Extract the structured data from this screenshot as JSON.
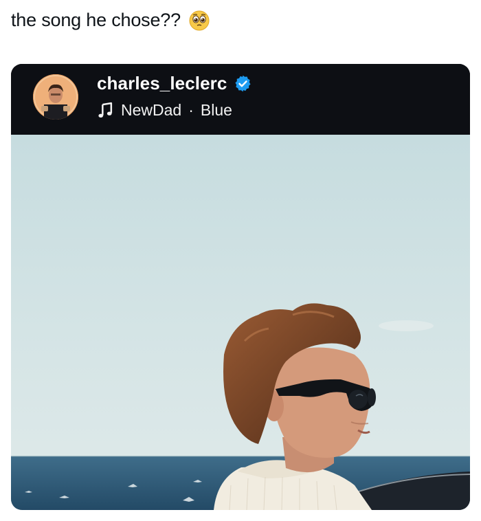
{
  "tweet": {
    "text": "the song he chose??",
    "emoji": "pleading-face-emoji"
  },
  "post": {
    "username": "charles_leclerc",
    "verified": true,
    "music": {
      "artist": "NewDad",
      "separator": "·",
      "title": "Blue"
    }
  },
  "colors": {
    "header_bg": "#0d0f14",
    "verified_blue": "#1d9bf0",
    "sky": "#cfe1e3",
    "sea": "#2e5b7a"
  },
  "icons": {
    "music": "music-note-icon",
    "verified": "verified-badge-icon"
  }
}
